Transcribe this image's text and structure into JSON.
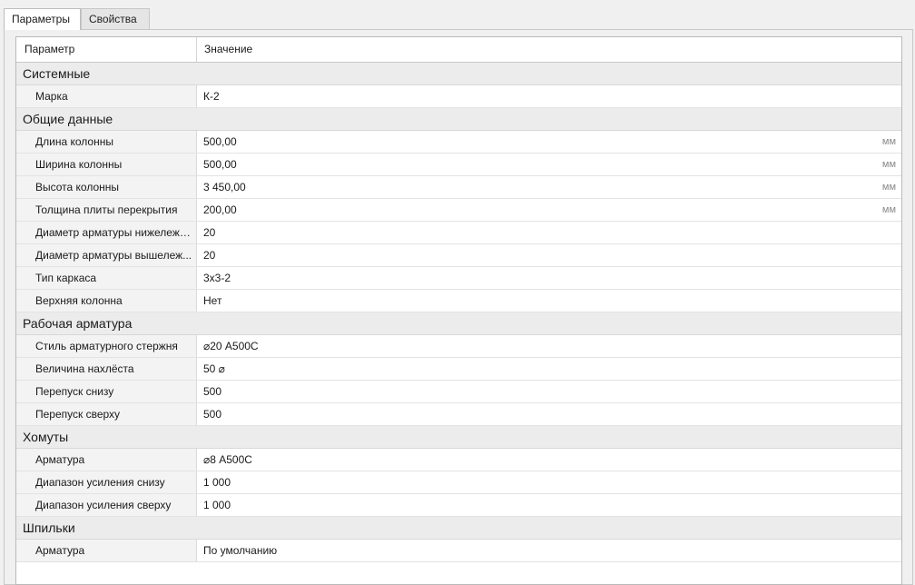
{
  "tabs": [
    {
      "label": "Параметры",
      "active": true
    },
    {
      "label": "Свойства",
      "active": false
    }
  ],
  "header": {
    "param": "Параметр",
    "value": "Значение"
  },
  "groups": [
    {
      "title": "Системные",
      "rows": [
        {
          "name": "Марка",
          "value": "К-2",
          "unit": ""
        }
      ]
    },
    {
      "title": "Общие данные",
      "rows": [
        {
          "name": "Длина колонны",
          "value": "500,00",
          "unit": "мм"
        },
        {
          "name": "Ширина колонны",
          "value": "500,00",
          "unit": "мм"
        },
        {
          "name": "Высота колонны",
          "value": "3 450,00",
          "unit": "мм"
        },
        {
          "name": "Толщина плиты перекрытия",
          "value": "200,00",
          "unit": "мм"
        },
        {
          "name": "Диаметр арматуры нижележе...",
          "value": "20",
          "unit": ""
        },
        {
          "name": "Диаметр арматуры вышележ...",
          "value": "20",
          "unit": ""
        },
        {
          "name": "Тип каркаса",
          "value": "3х3-2",
          "unit": ""
        },
        {
          "name": "Верхняя колонна",
          "value": "Нет",
          "unit": ""
        }
      ]
    },
    {
      "title": "Рабочая арматура",
      "rows": [
        {
          "name": "Стиль арматурного стержня",
          "value": "⌀20 А500С",
          "unit": ""
        },
        {
          "name": "Величина нахлёста",
          "value": "50 ⌀",
          "unit": ""
        },
        {
          "name": "Перепуск снизу",
          "value": "500",
          "unit": ""
        },
        {
          "name": "Перепуск сверху",
          "value": "500",
          "unit": ""
        }
      ]
    },
    {
      "title": "Хомуты",
      "rows": [
        {
          "name": "Арматура",
          "value": "⌀8 А500С",
          "unit": ""
        },
        {
          "name": "Диапазон усиления снизу",
          "value": "1 000",
          "unit": ""
        },
        {
          "name": "Диапазон усиления сверху",
          "value": "1 000",
          "unit": ""
        }
      ]
    },
    {
      "title": "Шпильки",
      "rows": [
        {
          "name": "Арматура",
          "value": "По умолчанию",
          "unit": ""
        }
      ]
    }
  ]
}
